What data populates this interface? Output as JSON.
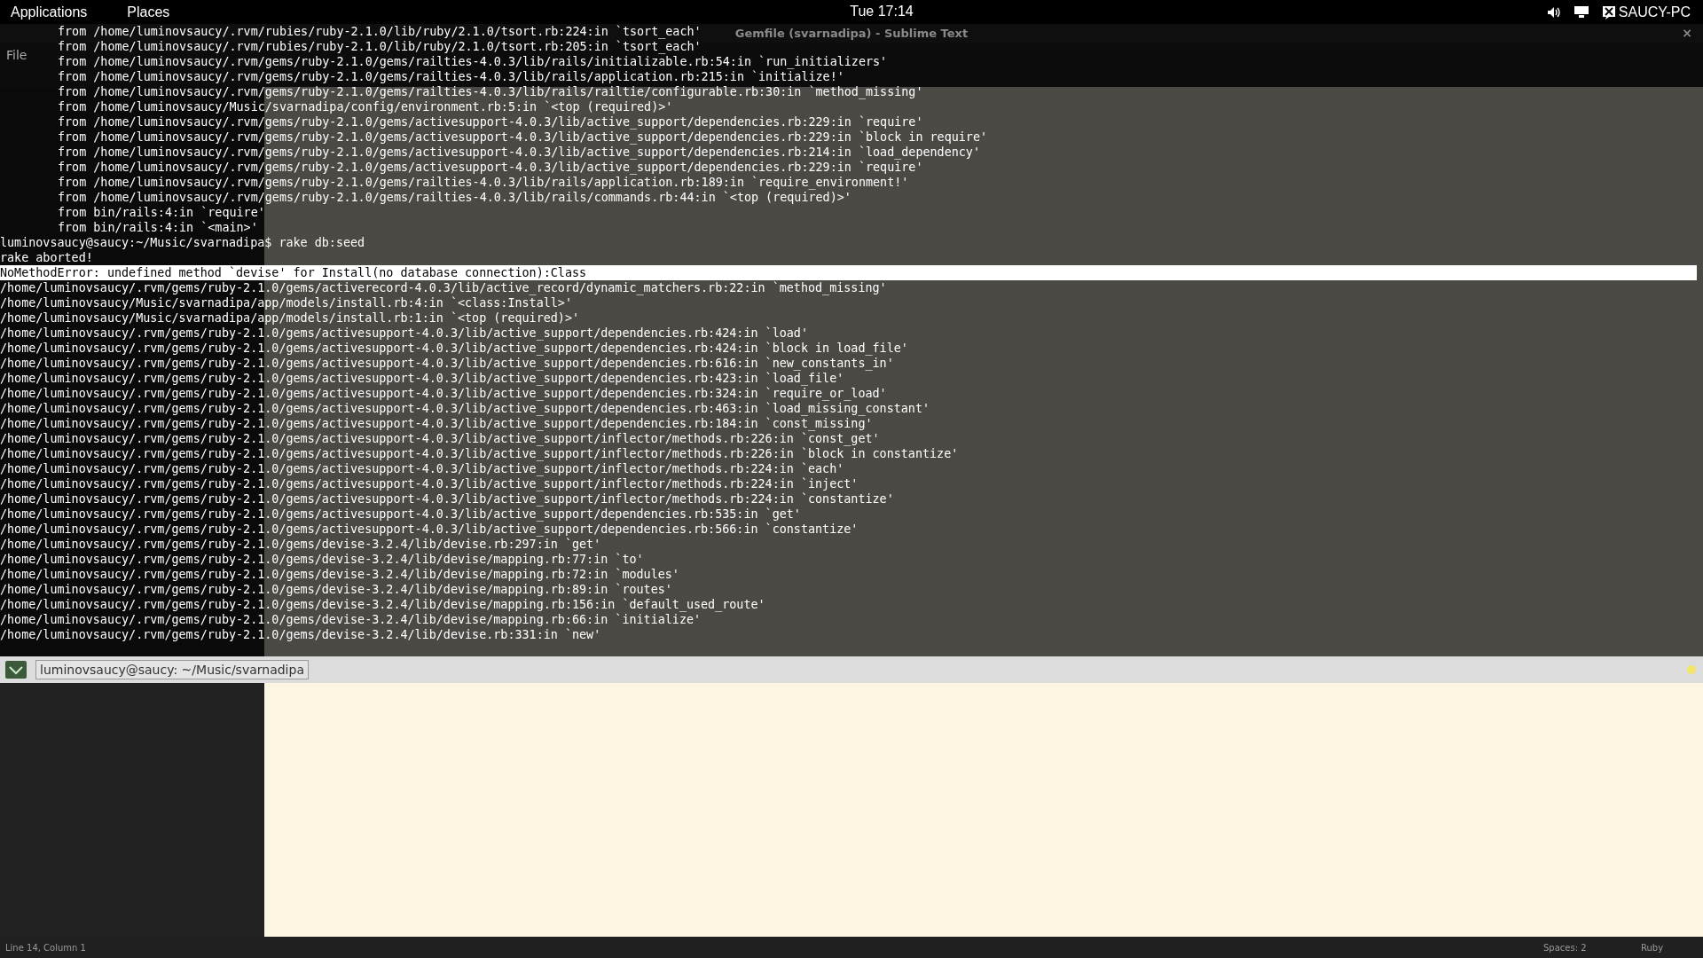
{
  "top_panel": {
    "menus": [
      "Applications",
      "Places"
    ],
    "clock": "Tue 17:14",
    "user": "SAUCY-PC"
  },
  "editor": {
    "title": "Gemfile (svarnadipa) - Sublime Text",
    "close": "×",
    "menu": [
      "File"
    ],
    "status_bar": {
      "position": "Line 14, Column 1",
      "indentation": "Spaces: 2",
      "syntax": "Ruby"
    }
  },
  "terminal": {
    "lines": [
      {
        "kind": "indented",
        "text": "from /home/luminovsaucy/.rvm/rubies/ruby-2.1.0/lib/ruby/2.1.0/tsort.rb:224:in `tsort_each'"
      },
      {
        "kind": "indented",
        "text": "from /home/luminovsaucy/.rvm/rubies/ruby-2.1.0/lib/ruby/2.1.0/tsort.rb:205:in `tsort_each'"
      },
      {
        "kind": "indented",
        "text": "from /home/luminovsaucy/.rvm/gems/ruby-2.1.0/gems/railties-4.0.3/lib/rails/initializable.rb:54:in `run_initializers'"
      },
      {
        "kind": "indented",
        "text": "from /home/luminovsaucy/.rvm/gems/ruby-2.1.0/gems/railties-4.0.3/lib/rails/application.rb:215:in `initialize!'"
      },
      {
        "kind": "indented",
        "text": "from /home/luminovsaucy/.rvm/gems/ruby-2.1.0/gems/railties-4.0.3/lib/rails/railtie/configurable.rb:30:in `method_missing'"
      },
      {
        "kind": "indented",
        "text": "from /home/luminovsaucy/Music/svarnadipa/config/environment.rb:5:in `<top (required)>'"
      },
      {
        "kind": "indented",
        "text": "from /home/luminovsaucy/.rvm/gems/ruby-2.1.0/gems/activesupport-4.0.3/lib/active_support/dependencies.rb:229:in `require'"
      },
      {
        "kind": "indented",
        "text": "from /home/luminovsaucy/.rvm/gems/ruby-2.1.0/gems/activesupport-4.0.3/lib/active_support/dependencies.rb:229:in `block in require'"
      },
      {
        "kind": "indented",
        "text": "from /home/luminovsaucy/.rvm/gems/ruby-2.1.0/gems/activesupport-4.0.3/lib/active_support/dependencies.rb:214:in `load_dependency'"
      },
      {
        "kind": "indented",
        "text": "from /home/luminovsaucy/.rvm/gems/ruby-2.1.0/gems/activesupport-4.0.3/lib/active_support/dependencies.rb:229:in `require'"
      },
      {
        "kind": "indented",
        "text": "from /home/luminovsaucy/.rvm/gems/ruby-2.1.0/gems/railties-4.0.3/lib/rails/application.rb:189:in `require_environment!'"
      },
      {
        "kind": "indented",
        "text": "from /home/luminovsaucy/.rvm/gems/ruby-2.1.0/gems/railties-4.0.3/lib/rails/commands.rb:44:in `<top (required)>'"
      },
      {
        "kind": "indented",
        "text": "from bin/rails:4:in `require'"
      },
      {
        "kind": "indented",
        "text": "from bin/rails:4:in `<main>'"
      },
      {
        "kind": "output",
        "text": "luminovsaucy@saucy:~/Music/svarnadipa$ rake db:seed"
      },
      {
        "kind": "output",
        "text": "rake aborted!"
      },
      {
        "kind": "highlighted",
        "text": "NoMethodError: undefined method `devise' for Install(no database connection):Class"
      },
      {
        "kind": "output",
        "text": "/home/luminovsaucy/.rvm/gems/ruby-2.1.0/gems/activerecord-4.0.3/lib/active_record/dynamic_matchers.rb:22:in `method_missing'"
      },
      {
        "kind": "output",
        "text": "/home/luminovsaucy/Music/svarnadipa/app/models/install.rb:4:in `<class:Install>'"
      },
      {
        "kind": "output",
        "text": "/home/luminovsaucy/Music/svarnadipa/app/models/install.rb:1:in `<top (required)>'"
      },
      {
        "kind": "output",
        "text": "/home/luminovsaucy/.rvm/gems/ruby-2.1.0/gems/activesupport-4.0.3/lib/active_support/dependencies.rb:424:in `load'"
      },
      {
        "kind": "output",
        "text": "/home/luminovsaucy/.rvm/gems/ruby-2.1.0/gems/activesupport-4.0.3/lib/active_support/dependencies.rb:424:in `block in load_file'"
      },
      {
        "kind": "output",
        "text": "/home/luminovsaucy/.rvm/gems/ruby-2.1.0/gems/activesupport-4.0.3/lib/active_support/dependencies.rb:616:in `new_constants_in'"
      },
      {
        "kind": "output",
        "text": "/home/luminovsaucy/.rvm/gems/ruby-2.1.0/gems/activesupport-4.0.3/lib/active_support/dependencies.rb:423:in `load_file'"
      },
      {
        "kind": "output",
        "text": "/home/luminovsaucy/.rvm/gems/ruby-2.1.0/gems/activesupport-4.0.3/lib/active_support/dependencies.rb:324:in `require_or_load'"
      },
      {
        "kind": "output",
        "text": "/home/luminovsaucy/.rvm/gems/ruby-2.1.0/gems/activesupport-4.0.3/lib/active_support/dependencies.rb:463:in `load_missing_constant'"
      },
      {
        "kind": "output",
        "text": "/home/luminovsaucy/.rvm/gems/ruby-2.1.0/gems/activesupport-4.0.3/lib/active_support/dependencies.rb:184:in `const_missing'"
      },
      {
        "kind": "output",
        "text": "/home/luminovsaucy/.rvm/gems/ruby-2.1.0/gems/activesupport-4.0.3/lib/active_support/inflector/methods.rb:226:in `const_get'"
      },
      {
        "kind": "output",
        "text": "/home/luminovsaucy/.rvm/gems/ruby-2.1.0/gems/activesupport-4.0.3/lib/active_support/inflector/methods.rb:226:in `block in constantize'"
      },
      {
        "kind": "output",
        "text": "/home/luminovsaucy/.rvm/gems/ruby-2.1.0/gems/activesupport-4.0.3/lib/active_support/inflector/methods.rb:224:in `each'"
      },
      {
        "kind": "output",
        "text": "/home/luminovsaucy/.rvm/gems/ruby-2.1.0/gems/activesupport-4.0.3/lib/active_support/inflector/methods.rb:224:in `inject'"
      },
      {
        "kind": "output",
        "text": "/home/luminovsaucy/.rvm/gems/ruby-2.1.0/gems/activesupport-4.0.3/lib/active_support/inflector/methods.rb:224:in `constantize'"
      },
      {
        "kind": "output",
        "text": "/home/luminovsaucy/.rvm/gems/ruby-2.1.0/gems/activesupport-4.0.3/lib/active_support/dependencies.rb:535:in `get'"
      },
      {
        "kind": "output",
        "text": "/home/luminovsaucy/.rvm/gems/ruby-2.1.0/gems/activesupport-4.0.3/lib/active_support/dependencies.rb:566:in `constantize'"
      },
      {
        "kind": "output",
        "text": "/home/luminovsaucy/.rvm/gems/ruby-2.1.0/gems/devise-3.2.4/lib/devise.rb:297:in `get'"
      },
      {
        "kind": "output",
        "text": "/home/luminovsaucy/.rvm/gems/ruby-2.1.0/gems/devise-3.2.4/lib/devise/mapping.rb:77:in `to'"
      },
      {
        "kind": "output",
        "text": "/home/luminovsaucy/.rvm/gems/ruby-2.1.0/gems/devise-3.2.4/lib/devise/mapping.rb:72:in `modules'"
      },
      {
        "kind": "output",
        "text": "/home/luminovsaucy/.rvm/gems/ruby-2.1.0/gems/devise-3.2.4/lib/devise/mapping.rb:89:in `routes'"
      },
      {
        "kind": "output",
        "text": "/home/luminovsaucy/.rvm/gems/ruby-2.1.0/gems/devise-3.2.4/lib/devise/mapping.rb:156:in `default_used_route'"
      },
      {
        "kind": "output",
        "text": "/home/luminovsaucy/.rvm/gems/ruby-2.1.0/gems/devise-3.2.4/lib/devise/mapping.rb:66:in `initialize'"
      },
      {
        "kind": "output",
        "text": "/home/luminovsaucy/.rvm/gems/ruby-2.1.0/gems/devise-3.2.4/lib/devise.rb:331:in `new'"
      }
    ]
  },
  "taskbar": {
    "items": [
      {
        "label": "luminovsaucy@saucy: ~/Music/svarnadipa",
        "selected": true
      }
    ]
  }
}
